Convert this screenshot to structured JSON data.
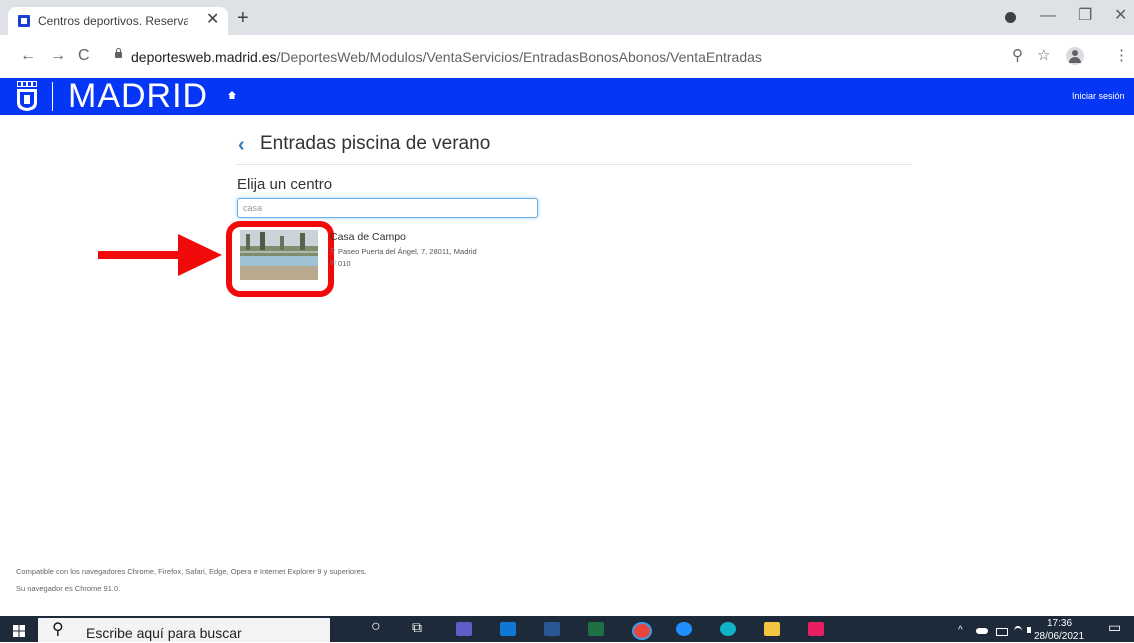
{
  "browser": {
    "tab_title": "Centros deportivos. Reserva, pag",
    "tab_close": "✕",
    "new_tab": "+",
    "url_domain": "deportesweb.madrid.es",
    "url_path": "/DeportesWeb/Modulos/VentaServicios/EntradasBonosAbonos/VentaEntradas",
    "back": "←",
    "forward": "→",
    "reload": "C",
    "minimize": "—",
    "restore": "❐",
    "close": "✕",
    "zoom_icon": "⚲",
    "star_icon": "☆",
    "menu_icon": "⋮"
  },
  "site": {
    "logo_text": "MADRID",
    "login_label": "Iniciar sesión",
    "brand_color": "#0536f6"
  },
  "page": {
    "back_chevron": "‹",
    "title": "Entradas piscina de verano",
    "section_label": "Elija un centro",
    "search_value": "casa"
  },
  "centers": [
    {
      "name": "Casa de Campo",
      "address": "Paseo Puerta del Ángel, 7, 28011, Madrid",
      "phone": "010",
      "pin_icon": "⚲",
      "phone_icon": "✆"
    }
  ],
  "footer": {
    "line1": "Compatible con los navegadores Chrome, Firefox, Safari, Edge, Opera e Internet Explorer 9 y superiores.",
    "line2": "Su navegador es Chrome 91.0."
  },
  "taskbar": {
    "search_placeholder": "Escribe aquí para buscar",
    "search_icon": "⚲",
    "cortana": "○",
    "taskview": "⧉",
    "time": "17:36",
    "date": "28/06/2021",
    "tray_up": "^",
    "notifications": "▭"
  }
}
